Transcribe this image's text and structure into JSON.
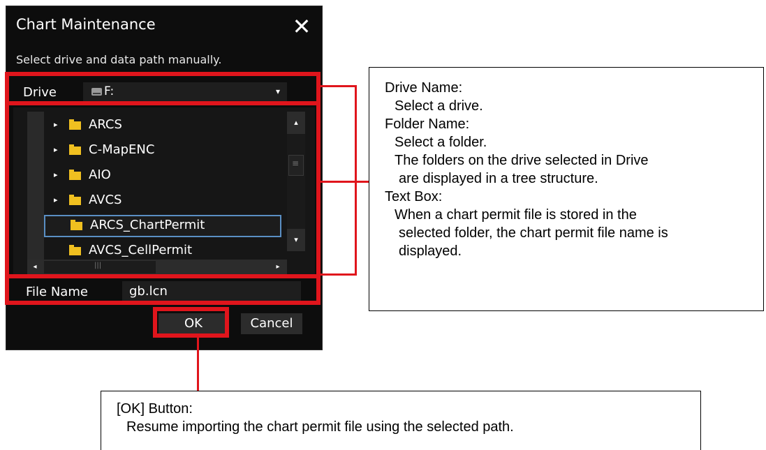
{
  "dialog": {
    "title": "Chart Maintenance",
    "close_glyph": "✕",
    "instruction": "Select drive and data path manually.",
    "drive": {
      "label": "Drive",
      "value": "F:",
      "arrow_glyph": "▾"
    },
    "tree": {
      "items": [
        {
          "label": "ARCS",
          "expander": "▸",
          "selected": false
        },
        {
          "label": "C-MapENC",
          "expander": "▸",
          "selected": false
        },
        {
          "label": "AIO",
          "expander": "▸",
          "selected": false
        },
        {
          "label": "AVCS",
          "expander": "▸",
          "selected": false
        },
        {
          "label": "ARCS_ChartPermit",
          "expander": "",
          "selected": true
        },
        {
          "label": "AVCS_CellPermit",
          "expander": "",
          "selected": false
        }
      ],
      "scroll_up_glyph": "▴",
      "scroll_down_glyph": "▾",
      "scroll_left_glyph": "◂",
      "scroll_right_glyph": "▸"
    },
    "file_name": {
      "label": "File Name",
      "value": "gb.lcn"
    },
    "buttons": {
      "ok": "OK",
      "cancel": "Cancel"
    }
  },
  "callouts": {
    "right": {
      "lines": [
        "Drive Name:",
        "Select a drive.",
        "Folder Name:",
        "Select a folder.",
        "The folders on the drive selected in Drive",
        "are displayed in a tree structure.",
        "Text Box:",
        "When a chart permit file is stored in the",
        "selected folder, the chart permit file name is",
        "displayed."
      ]
    },
    "bottom": {
      "lines": [
        "[OK] Button:",
        "Resume importing the chart permit file using the selected path."
      ]
    }
  },
  "colors": {
    "highlight": "#e0151c",
    "dialog_bg": "#0d0d0d",
    "folder": "#f0c020",
    "selection_border": "#5a8fc4"
  }
}
